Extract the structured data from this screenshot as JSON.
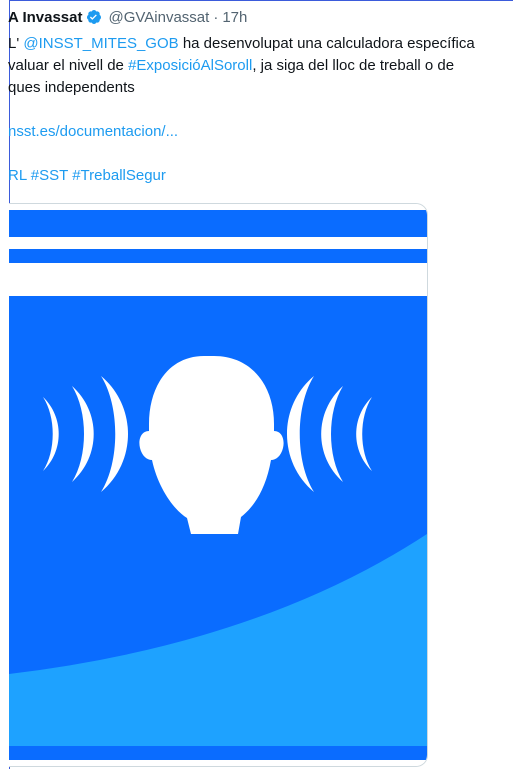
{
  "tweet": {
    "display_name": "A Invassat",
    "handle": "@GVAinvassat",
    "separator": "·",
    "time": "17h",
    "line1": {
      "prefix": "L'",
      "mention": "@INSST_MITES_GOB",
      "rest": " ha desenvolupat una calculadora específica"
    },
    "line2": {
      "prefix": "valuar el nivell de ",
      "hashtag": "#ExposicióAlSoroll",
      "rest": ", ja siga del lloc de treball o de"
    },
    "line3": "ques independents",
    "url": "nsst.es/documentacion/...",
    "hashtags": [
      "RL",
      "#SST",
      "#TreballSegur"
    ],
    "media_image": "hearing-noise-icon"
  },
  "colors": {
    "link": "#1d9bf0",
    "verified": "#1d9bf0",
    "image_blue_dark": "#0a6cff",
    "image_blue_light": "#1ea2ff"
  }
}
